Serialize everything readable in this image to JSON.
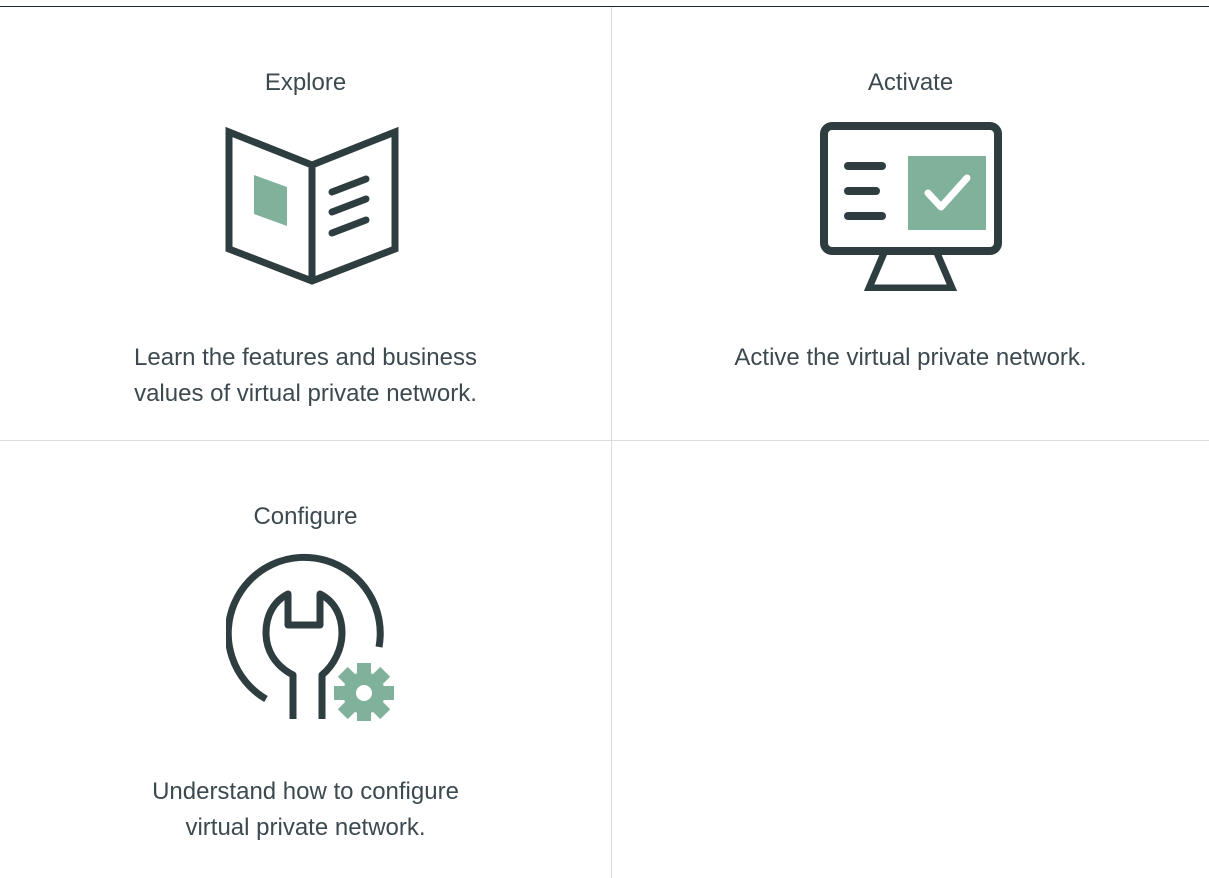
{
  "cards": [
    {
      "title": "Explore",
      "icon": "book-icon",
      "description_lines": [
        "Learn the features and business",
        "values of virtual private network."
      ]
    },
    {
      "title": "Activate",
      "icon": "monitor-check-icon",
      "description_lines": [
        "Active the virtual private network."
      ]
    },
    {
      "title": "Configure",
      "icon": "wrench-gear-icon",
      "description_lines": [
        "Understand how to configure",
        "virtual private network."
      ]
    }
  ],
  "colors": {
    "icon_dark": "#2e3d3f",
    "icon_accent": "#80b29b",
    "text": "#3c4a50",
    "divider": "#d9dcdd"
  }
}
